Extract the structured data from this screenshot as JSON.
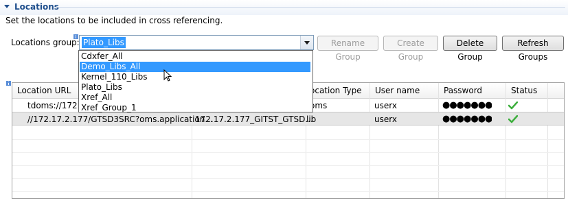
{
  "section": {
    "title": "Locations",
    "description": "Set the locations to be included in cross referencing."
  },
  "group": {
    "label": "Locations group:",
    "selected": "Plato_Libs",
    "options": [
      "Cdxfer_All",
      "Demo_Libs_All",
      "Kernel_110_Libs",
      "Plato_Libs",
      "Xref_All",
      "Xref_Group_1"
    ],
    "highlighted": "Demo_Libs_All"
  },
  "buttons": {
    "rename": "Rename Group",
    "create": "Create Group",
    "delete": "Delete Group",
    "refresh": "Refresh Groups"
  },
  "table": {
    "columns": [
      "Location URL",
      "",
      "ocation Type",
      "User name",
      "Password",
      "Status"
    ],
    "rows": [
      {
        "url": "tdoms://172.1",
        "name": "",
        "type": "oms",
        "user": "userx",
        "password": "●●●●●●●",
        "status": "ok"
      },
      {
        "url": "//172.17.2.177/GTSD3SRC?oms.application...",
        "name": "172.17.2.177_GITST_GTSD...",
        "type": "lib",
        "user": "userx",
        "password": "●●●●●●●",
        "status": "ok"
      }
    ]
  },
  "colors": {
    "selection": "#3399ff",
    "section_title": "#1e4e8c",
    "check": "#3cae3c"
  }
}
